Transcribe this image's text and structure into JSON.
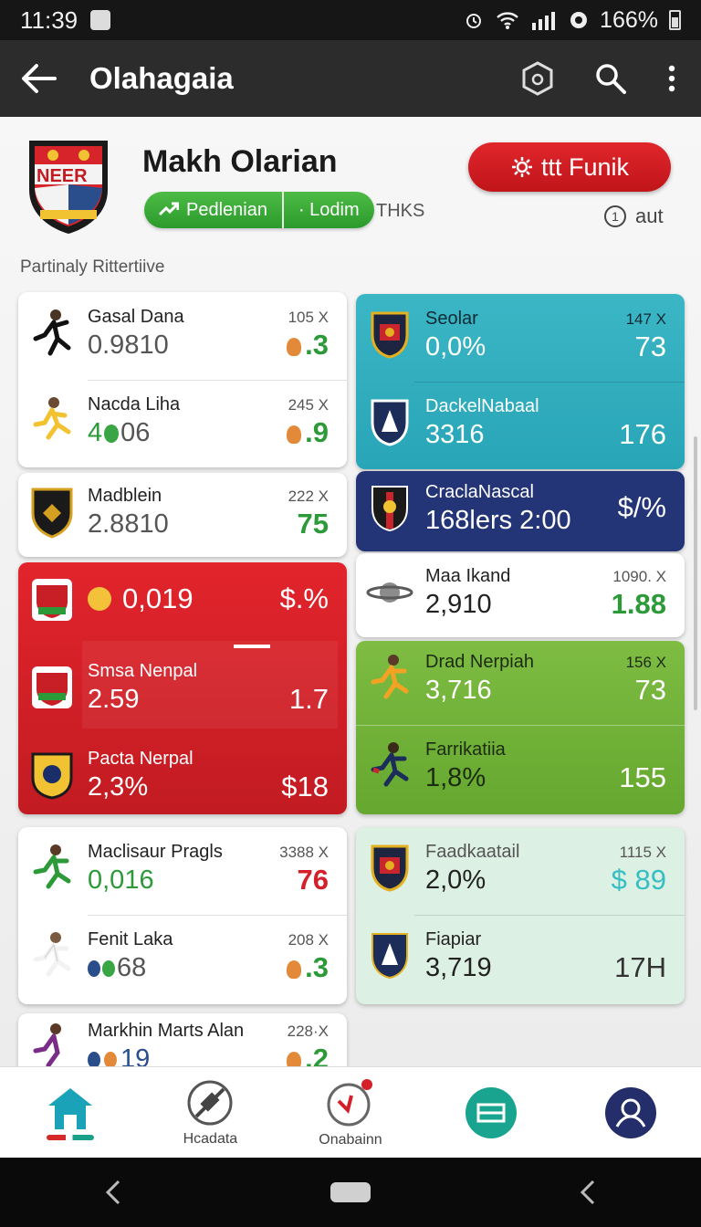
{
  "status": {
    "time": "11:39",
    "battery": "166%"
  },
  "app": {
    "title": "Olahagaia"
  },
  "profile": {
    "name": "Makh Olarian",
    "crest_text": "NEER",
    "pill_1": "Pedlenian",
    "pill_2": "· Lodim",
    "tag": "THKS",
    "action_button": "ttt Funik",
    "info_text": "aut"
  },
  "section_label": "Partinaly Rittertiive",
  "cards": {
    "left_top": [
      {
        "name": "Gasal Dana",
        "big": "0.9810",
        "meta": "105 X",
        "val": ".3"
      },
      {
        "name": "Nacda Liha",
        "big": "4🟢06",
        "big_prefix": "4",
        "big_suffix": "06",
        "meta": "245 X",
        "val": ".9"
      }
    ],
    "left_single": {
      "name": "Madblein",
      "big": "2.8810",
      "meta": "222 X",
      "val": "75"
    },
    "red": [
      {
        "name": "",
        "big": "0,019",
        "val": "$.%"
      },
      {
        "name": "Smsa Nenpal",
        "big": "2.59",
        "val": "1.7"
      },
      {
        "name": "Pacta Nerpal",
        "big": "2,3%",
        "val": "$18"
      }
    ],
    "left_bottom": [
      {
        "name": "Maclisaur Pragls",
        "big": "0,016",
        "meta": "3388 X",
        "val": "76"
      },
      {
        "name": "Fenit Laka",
        "big": "68",
        "meta": "208 X",
        "val": ".3"
      }
    ],
    "left_partial": {
      "name": "Markhin Marts Alan",
      "big": "19",
      "meta": "228·X",
      "val": ".2"
    },
    "teal": [
      {
        "name": "Seolar",
        "big": "0,0%",
        "meta": "147 X",
        "val": "73"
      },
      {
        "name": "DackelNabaal",
        "big": "3316",
        "val": "176"
      }
    ],
    "navy": {
      "name": "CraclaNascal",
      "big": "168lers 2:00",
      "val": "$/%"
    },
    "white_right": {
      "name": "Maa Ikand",
      "big": "2,910",
      "meta": "1090. X",
      "val": "1.88"
    },
    "green": [
      {
        "name": "Drad Nerpiah",
        "big": "3,716",
        "meta": "156 X",
        "val": "73"
      },
      {
        "name": "Farrikatiia",
        "big": "1,8%",
        "val": "155"
      }
    ],
    "mint": [
      {
        "name": "Faadkaatail",
        "big": "2,0%",
        "meta": "1115 X",
        "val": "$ 89"
      },
      {
        "name": "Fiapiar",
        "big": "3,719",
        "val": "17H"
      }
    ]
  },
  "nav": {
    "item_2": "Hcadata",
    "item_3": "Onabainn"
  },
  "colors": {
    "accent_red": "#e0262b",
    "accent_green": "#3aaa3a",
    "teal": "#2aa7b8",
    "navy": "#243577"
  }
}
